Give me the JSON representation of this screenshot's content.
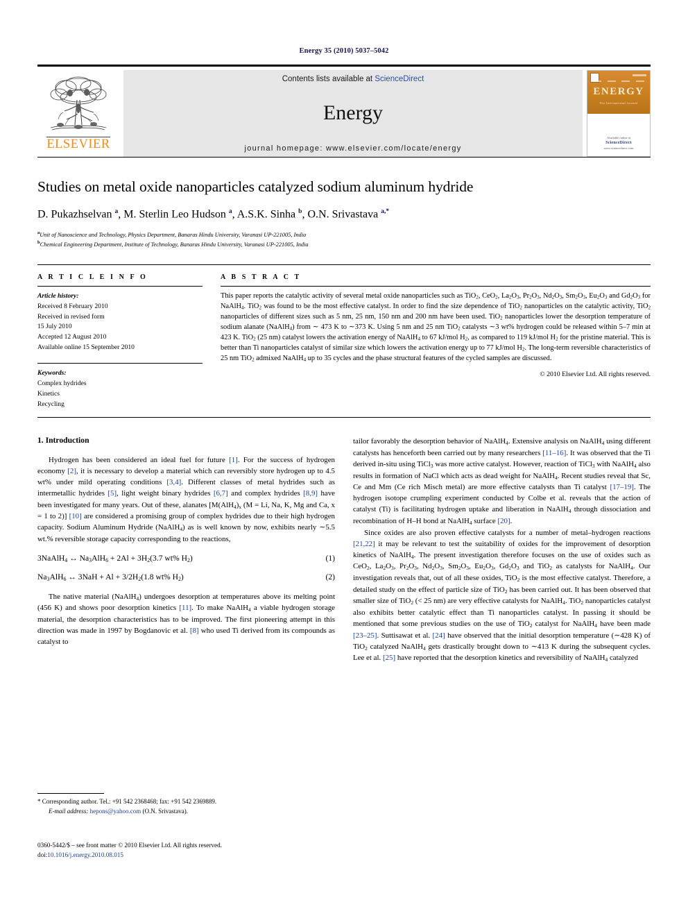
{
  "running_head": "Energy 35 (2010) 5037–5042",
  "masthead": {
    "publisher_name": "ELSEVIER",
    "contents_prefix": "Contents lists available at ",
    "contents_link": "ScienceDirect",
    "journal_name": "Energy",
    "homepage": "journal homepage: www.elsevier.com/locate/energy",
    "cover": {
      "title": "ENERGY",
      "subtitle": "The International Journal",
      "footer_small": "Available online at",
      "footer_brand": "ScienceDirect",
      "footer_url": "www.sciencedirect.com"
    }
  },
  "article": {
    "title": "Studies on metal oxide nanoparticles catalyzed sodium aluminum hydride",
    "authors_html": "D. Pukazhselvan <sup>a</sup>, M. Sterlin Leo Hudson <sup>a</sup>, A.S.K. Sinha <sup>b</sup>, O.N. Srivastava <sup>a,*</sup>",
    "affiliations": [
      "Unit of Nanoscience and Technology, Physics Department, Banaras Hindu University, Varanasi UP-221005, India",
      "Chemical Engineering Department, Institute of Technology, Banaras Hindu University, Varanasi UP-221005, India"
    ],
    "affiliation_marks": [
      "a",
      "b"
    ]
  },
  "article_info": {
    "heading": "A R T I C L E  I N F O",
    "history_label": "Article history:",
    "history": [
      "Received 8 February 2010",
      "Received in revised form",
      "15 July 2010",
      "Accepted 12 August 2010",
      "Available online 15 September 2010"
    ],
    "keywords_label": "Keywords:",
    "keywords": [
      "Complex hydrides",
      "Kinetics",
      "Recycling"
    ]
  },
  "abstract": {
    "heading": "A B S T R A C T",
    "text_html": "This paper reports the catalytic activity of several metal oxide nanoparticles such as TiO<sub>2</sub>, CeO<sub>2</sub>, La<sub>2</sub>O<sub>3</sub>, Pr<sub>2</sub>O<sub>3</sub>, Nd<sub>2</sub>O<sub>3</sub>, Sm<sub>2</sub>O<sub>3</sub>, Eu<sub>2</sub>O<sub>3</sub> and Gd<sub>2</sub>O<sub>3</sub> for NaAlH<sub>4</sub>. TiO<sub>2</sub> was found to be the most effective catalyst. In order to find the size dependence of TiO<sub>2</sub> nanoparticles on the catalytic activity, TiO<sub>2</sub> nanoparticles of different sizes such as 5 nm, 25 nm, 150 nm and 200 nm have been used. TiO<sub>2</sub> nanoparticles lower the desorption temperature of sodium alanate (NaAlH<sub>4</sub>) from ∼ 473 K to ∼373 K. Using 5 nm and 25 nm TiO<sub>2</sub> catalysts ∼3 wt% hydrogen could be released within 5–7 min at 423 K. TiO<sub>2</sub> (25 nm) catalyst lowers the activation energy of NaAlH<sub>4</sub> to 67 kJ/mol H<sub>2</sub>, as compared to 119 kJ/mol H<sub>2</sub> for the pristine material. This is better than Ti nanoparticles catalyst of similar size which lowers the activation energy up to 77 kJ/mol H<sub>2</sub>. The long-term reversible characteristics of 25 nm TiO<sub>2</sub> admixed NaAlH<sub>4</sub> up to 35 cycles and the phase structural features of the cycled samples are discussed.",
    "copyright": "© 2010 Elsevier Ltd. All rights reserved."
  },
  "body": {
    "section_title": "1.  Introduction",
    "left_paragraphs_html": [
      "Hydrogen has been considered an ideal fuel for future <span class=\"ref\">[1]</span>. For the success of hydrogen economy <span class=\"ref\">[2]</span>, it is necessary to develop a material which can reversibly store hydrogen up to 4.5 wt% under mild operating conditions <span class=\"ref\">[3,4]</span>. Different classes of metal hydrides such as intermetallic hydrides <span class=\"ref\">[5]</span>, light weight binary hydrides <span class=\"ref\">[6,7]</span> and complex hydrides <span class=\"ref\">[8,9]</span> have been investigated for many years. Out of these, alanates [M(AlH<sub>4</sub>)<sub>x</sub> (M = Li, Na, K, Mg and Ca, x = 1 to 2)] <span class=\"ref\">[10]</span> are considered a promising group of complex hydrides due to their high hydrogen capacity. Sodium Aluminum Hydride (NaAlH<sub>4</sub>) as is well known by now, exhibits nearly ∼5.5 wt.% reversible storage capacity corresponding to the reactions,"
    ],
    "equations": [
      {
        "expr_html": "3NaAlH<sub>4</sub> ↔ Na<sub>3</sub>AlH<sub>6</sub> + 2Al + 3H<sub>2</sub>(3.7 wt% H<sub>2</sub>)",
        "number": "(1)"
      },
      {
        "expr_html": "Na<sub>3</sub>AlH<sub>6</sub> ↔ 3NaH + Al + 3/2H<sub>2</sub>(1.8 wt% H<sub>2</sub>)",
        "number": "(2)"
      }
    ],
    "left_paragraphs_after_html": [
      "The native material (NaAlH<sub>4</sub>) undergoes desorption at temperatures above its melting point (456 K) and shows poor desorption kinetics <span class=\"ref\">[11]</span>. To make NaAlH<sub>4</sub> a viable hydrogen storage material, the desorption characteristics has to be improved. The first pioneering attempt in this direction was made in 1997 by Bogdanovic et al. <span class=\"ref\">[8]</span> who used Ti derived from its compounds as catalyst to"
    ],
    "right_paragraphs_html": [
      "tailor favorably the desorption behavior of NaAlH<sub>4</sub>. Extensive analysis on NaAlH<sub>4</sub> using different catalysts has henceforth been carried out by many researchers <span class=\"ref\">[11–16]</span>. It was observed that the Ti derived in-situ using TiCl<sub>3</sub> was more active catalyst. However, reaction of TiCl<sub>3</sub> with NaAlH<sub>4</sub> also results in formation of NaCl which acts as dead weight for NaAlH<sub>4</sub>. Recent studies reveal that Sc, Ce and Mm (Ce rich Misch metal) are more effective catalysts than Ti catalyst <span class=\"ref\">[17–19]</span>. The hydrogen isotope crumpling experiment conducted by Colbe et al. reveals that the action of catalyst (Ti) is facilitating hydrogen uptake and liberation in NaAlH<sub>4</sub> through dissociation and recombination of H–H bond at NaAlH<sub>4</sub> surface <span class=\"ref\">[20]</span>.",
      "Since oxides are also proven effective catalysts for a number of metal–hydrogen reactions <span class=\"ref\">[21,22]</span> it may be relevant to test the suitability of oxides for the improvement of desorption kinetics of NaAlH<sub>4</sub>. The present investigation therefore focuses on the use of oxides such as CeO<sub>2</sub>, La<sub>2</sub>O<sub>3</sub>, Pr<sub>2</sub>O<sub>3</sub>, Nd<sub>2</sub>O<sub>3</sub>, Sm<sub>2</sub>O<sub>3</sub>, Eu<sub>2</sub>O<sub>3</sub>, Gd<sub>2</sub>O<sub>3</sub> and TiO<sub>2</sub> as catalysts for NaAlH<sub>4</sub>. Our investigation reveals that, out of all these oxides, TiO<sub>2</sub> is the most effective catalyst. Therefore, a detailed study on the effect of particle size of TiO<sub>2</sub> has been carried out. It has been observed that smaller size of TiO<sub>2</sub> (&lt; 25 nm) are very effective catalysts for NaAlH<sub>4</sub>. TiO<sub>2</sub> nanoparticles catalyst also exhibits better catalytic effect than Ti nanoparticles catalyst. In passing it should be mentioned that some previous studies on the use of TiO<sub>2</sub> catalyst for NaAlH<sub>4</sub> have been made <span class=\"ref\">[23–25]</span>. Suttisawat et al. <span class=\"ref\">[24]</span> have observed that the initial desorption temperature (∼428 K) of TiO<sub>2</sub> catalyzed NaAlH<sub>4</sub> gets drastically brought down to ∼413 K during the subsequent cycles. Lee et al. <span class=\"ref\">[25]</span> have reported that the desorption kinetics and reversibility of NaAlH<sub>4</sub> catalyzed"
    ]
  },
  "footnote": {
    "star": "*",
    "corresponding_html": "Corresponding author. Tel.: +91 542 2368468; fax: +91 542 2369889.",
    "email_label": "E-mail address:",
    "email": "hepons@yahoo.com",
    "email_owner": "(O.N. Srivastava)."
  },
  "footer": {
    "issn_html": "0360-5442/$ – see front matter © 2010 Elsevier Ltd. All rights reserved.",
    "doi_label": "doi:",
    "doi": "10.1016/j.energy.2010.08.015"
  },
  "colors": {
    "link_blue": "#1b3f94",
    "header_navy": "#141452",
    "elsevier_orange": "#F08C1E",
    "band_gray": "#e6e6e6"
  }
}
